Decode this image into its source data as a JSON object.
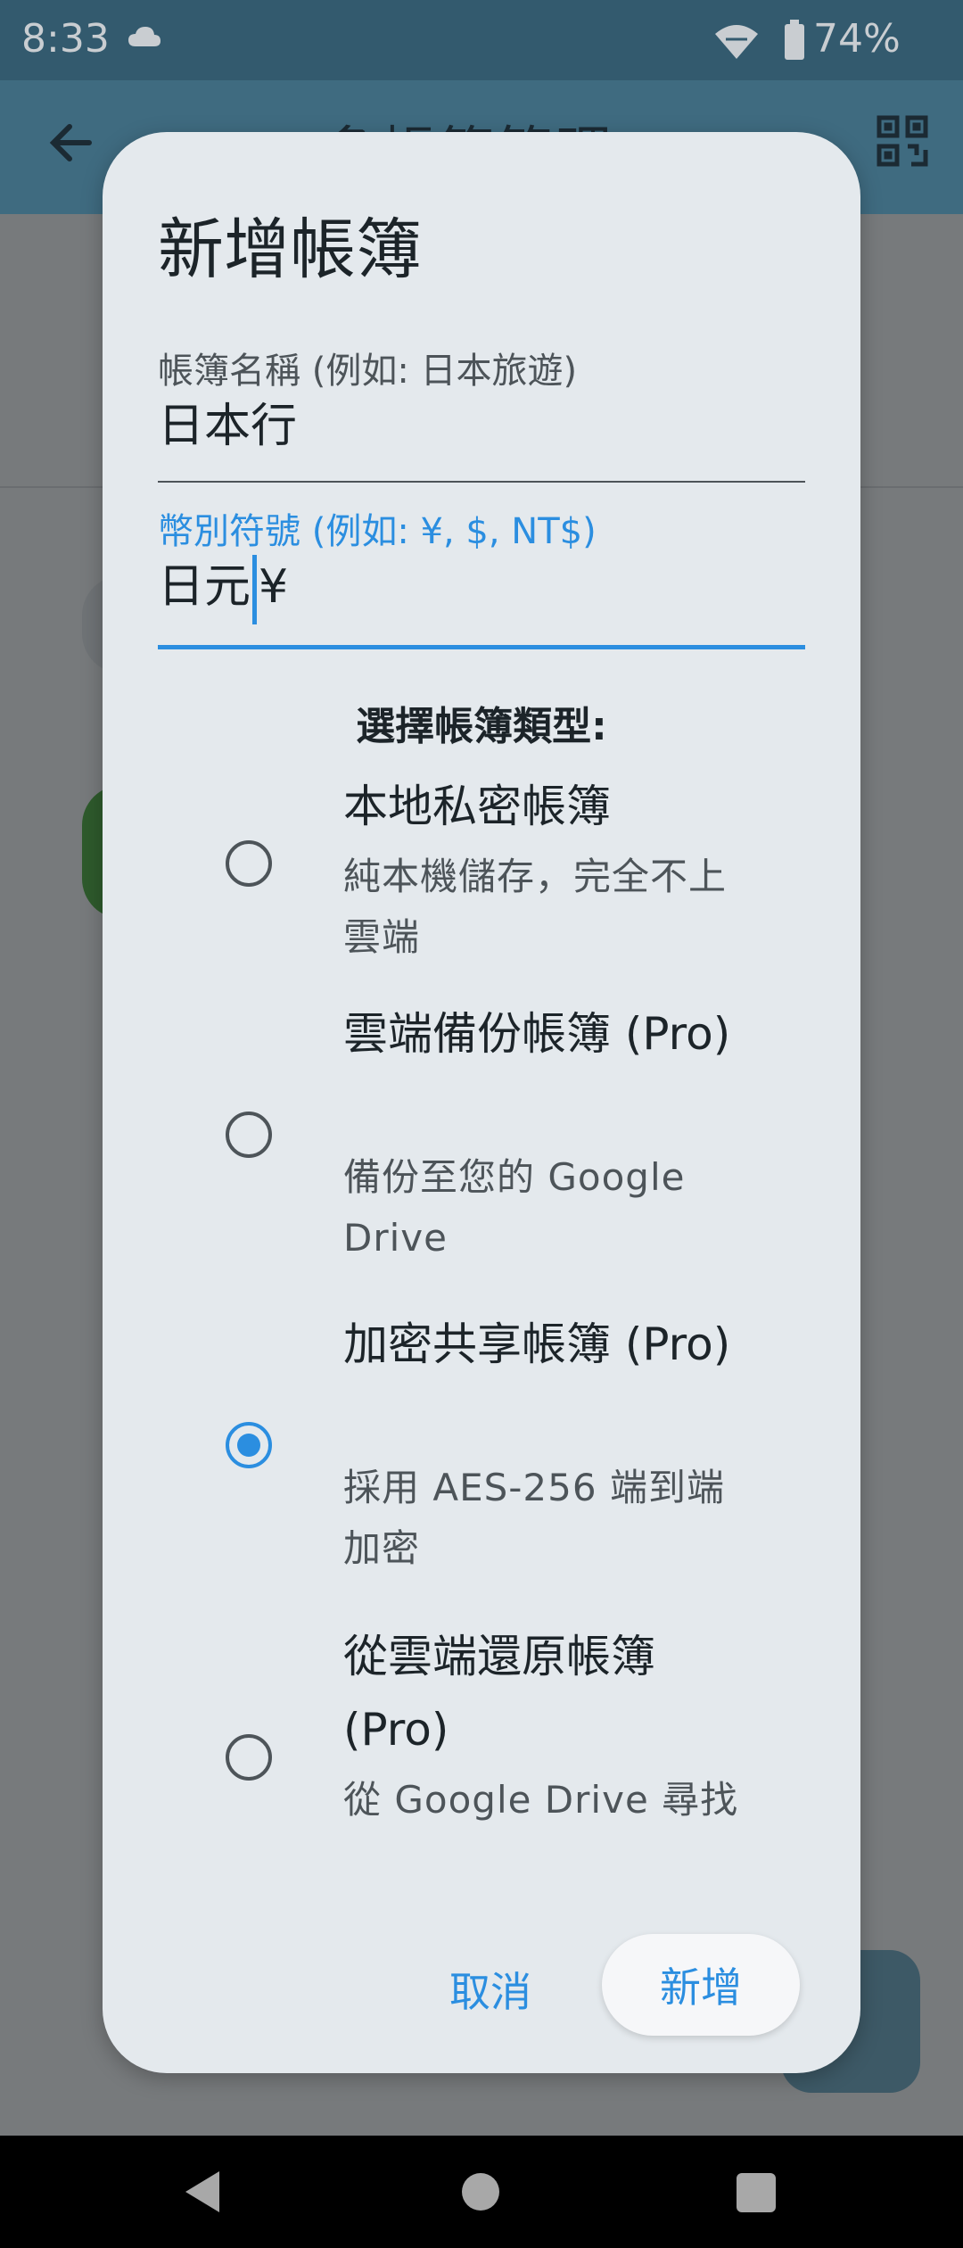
{
  "status_bar": {
    "time": "8:33",
    "battery": "74%"
  },
  "app_bar": {
    "title": "多帳簿管理"
  },
  "dialog": {
    "title": "新增帳簿",
    "name_field": {
      "label": "帳簿名稱 (例如: 日本旅遊)",
      "value": "日本行"
    },
    "currency_field": {
      "label": "幣別符號 (例如: ¥, $, NT$)",
      "value_before_cursor": "日元",
      "value_after_cursor": "¥"
    },
    "section_title": "選擇帳簿類型:",
    "options": [
      {
        "title": "本地私密帳簿",
        "subtitle": "純本機儲存，完全不上雲端",
        "selected": false
      },
      {
        "title": "雲端備份帳簿 (Pro)",
        "subtitle": "備份至您的 Google Drive",
        "selected": false
      },
      {
        "title": "加密共享帳簿 (Pro)",
        "subtitle": "採用 AES-256 端到端加密",
        "selected": true
      },
      {
        "title": "從雲端還原帳簿 (Pro)",
        "subtitle": "從 Google Drive 尋找",
        "selected": false
      }
    ],
    "cancel_label": "取消",
    "confirm_label": "新增"
  },
  "colors": {
    "accent": "#2b8ee0",
    "dialog_bg": "#e4e9ed",
    "app_bar": "#3f6b80"
  }
}
